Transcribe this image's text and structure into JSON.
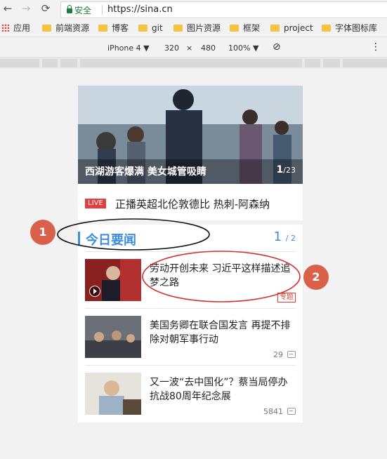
{
  "browser": {
    "secure_label": "安全",
    "url": "https://sina.cn",
    "bookmarks": [
      "应用",
      "前端资源",
      "博客",
      "git",
      "图片资源",
      "框架",
      "project",
      "字体图标库"
    ]
  },
  "devtools": {
    "device": "iPhone 4 ▼",
    "width": "320",
    "times": "×",
    "height": "480",
    "zoom": "100% ▼"
  },
  "page": {
    "carousel": {
      "caption": "西湖游客爆满 美女城管吸睛",
      "index": "1",
      "total": "/23"
    },
    "live": {
      "badge": "LIVE",
      "text": "正播英超北伦敦德比 热刺-阿森纳"
    },
    "section": {
      "title": "今日要闻",
      "page": "1",
      "page_total": "/ 2"
    },
    "news": [
      {
        "title": "劳动开创未来 习近平这样描述追梦之路",
        "tag": "专题",
        "comments": ""
      },
      {
        "title": "美国务卿在联合国发言 再提不排除对朝军事行动",
        "tag": "",
        "comments": "29"
      },
      {
        "title": "又一波“去中国化”？蔡当局停办抗战80周年纪念展",
        "tag": "",
        "comments": "5841"
      }
    ]
  },
  "annotations": {
    "marker1": "1",
    "marker2": "2"
  },
  "colors": {
    "accent": "#3d8cde",
    "live": "#e43d3d",
    "marker": "#d9604a"
  }
}
